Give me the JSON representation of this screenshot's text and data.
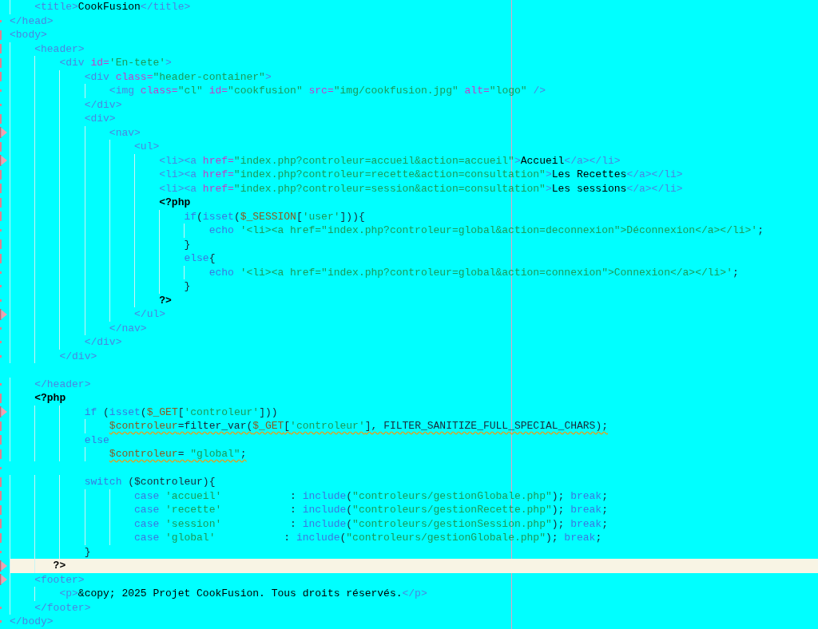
{
  "editor": {
    "lines": [
      {
        "current": false,
        "warning": false,
        "tokens": [
          {
            "kind": "tag",
            "text": "    <title>"
          },
          {
            "kind": "text",
            "text": "CookFusion"
          },
          {
            "kind": "tag",
            "text": "</title>"
          }
        ]
      },
      {
        "marker": {
          "kind": "dot"
        },
        "current": false,
        "warning": false,
        "tokens": [
          {
            "kind": "tag",
            "text": "</head>"
          }
        ]
      },
      {
        "marker": {
          "kind": "bar"
        },
        "current": false,
        "warning": false,
        "tokens": [
          {
            "kind": "tag",
            "text": "<body>"
          }
        ]
      },
      {
        "marker": {
          "kind": "bar"
        },
        "current": false,
        "warning": false,
        "tokens": [
          {
            "kind": "tag",
            "text": "    <header>"
          }
        ]
      },
      {
        "marker": {
          "kind": "bar"
        },
        "current": false,
        "warning": false,
        "tokens": [
          {
            "kind": "tag",
            "text": "        <div "
          },
          {
            "kind": "attr",
            "text": "id="
          },
          {
            "kind": "string",
            "text": "'En-tete'"
          },
          {
            "kind": "tag",
            "text": ">"
          }
        ]
      },
      {
        "marker": {
          "kind": "bar"
        },
        "current": false,
        "warning": false,
        "tokens": [
          {
            "kind": "tag",
            "text": "            <div "
          },
          {
            "kind": "attr",
            "text": "class="
          },
          {
            "kind": "string",
            "text": "\"header-container\""
          },
          {
            "kind": "tag",
            "text": ">"
          }
        ]
      },
      {
        "marker": {
          "kind": "dot"
        },
        "current": false,
        "warning": false,
        "tokens": [
          {
            "kind": "tag",
            "text": "                <img "
          },
          {
            "kind": "attr",
            "text": "class="
          },
          {
            "kind": "string",
            "text": "\"cl\""
          },
          {
            "kind": "attr",
            "text": " id="
          },
          {
            "kind": "string",
            "text": "\"cookfusion\""
          },
          {
            "kind": "attr",
            "text": " src="
          },
          {
            "kind": "string",
            "text": "\"img/cookfusion.jpg\""
          },
          {
            "kind": "attr",
            "text": " alt="
          },
          {
            "kind": "string",
            "text": "\"logo\""
          },
          {
            "kind": "tag",
            "text": " />"
          }
        ]
      },
      {
        "marker": {
          "kind": "dot"
        },
        "current": false,
        "warning": false,
        "tokens": [
          {
            "kind": "tag",
            "text": "            </div>"
          }
        ]
      },
      {
        "marker": {
          "kind": "bar"
        },
        "current": false,
        "warning": false,
        "tokens": [
          {
            "kind": "tag",
            "text": "            <div>"
          }
        ]
      },
      {
        "marker": {
          "kind": "arrow"
        },
        "current": false,
        "warning": false,
        "tokens": [
          {
            "kind": "tag",
            "text": "                <nav>"
          }
        ]
      },
      {
        "marker": {
          "kind": "bar"
        },
        "current": false,
        "warning": false,
        "tokens": [
          {
            "kind": "tag",
            "text": "                    <ul>"
          }
        ]
      },
      {
        "marker": {
          "kind": "arrow"
        },
        "current": false,
        "warning": false,
        "tokens": [
          {
            "kind": "tag",
            "text": "                        <li><a "
          },
          {
            "kind": "attr",
            "text": "href="
          },
          {
            "kind": "string",
            "text": "\"index.php?controleur=accueil&action=accueil\""
          },
          {
            "kind": "tag",
            "text": ">"
          },
          {
            "kind": "text",
            "text": "Accueil"
          },
          {
            "kind": "tag",
            "text": "</a></li>"
          }
        ]
      },
      {
        "marker": {
          "kind": "bar"
        },
        "current": false,
        "warning": false,
        "tokens": [
          {
            "kind": "tag",
            "text": "                        <li><a "
          },
          {
            "kind": "attr",
            "text": "href="
          },
          {
            "kind": "string",
            "text": "\"index.php?controleur=recette&action=consultation\""
          },
          {
            "kind": "tag",
            "text": ">"
          },
          {
            "kind": "text",
            "text": "Les Recettes"
          },
          {
            "kind": "tag",
            "text": "</a></li>"
          }
        ]
      },
      {
        "marker": {
          "kind": "bar"
        },
        "current": false,
        "warning": false,
        "tokens": [
          {
            "kind": "tag",
            "text": "                        <li><a "
          },
          {
            "kind": "attr",
            "text": "href="
          },
          {
            "kind": "string",
            "text": "\"index.php?controleur=session&action=consultation\""
          },
          {
            "kind": "tag",
            "text": ">"
          },
          {
            "kind": "text",
            "text": "Les sessions"
          },
          {
            "kind": "tag",
            "text": "</a></li>"
          }
        ]
      },
      {
        "marker": {
          "kind": "bar"
        },
        "current": false,
        "warning": false,
        "tokens": [
          {
            "kind": "php",
            "text": "                        <?php"
          }
        ]
      },
      {
        "marker": {
          "kind": "bar"
        },
        "current": false,
        "warning": false,
        "tokens": [
          {
            "kind": "keyword",
            "text": "                            if"
          },
          {
            "kind": "plain",
            "text": "("
          },
          {
            "kind": "keyword",
            "text": "isset"
          },
          {
            "kind": "plain",
            "text": "("
          },
          {
            "kind": "var",
            "text": "$_SESSION"
          },
          {
            "kind": "plain",
            "text": "["
          },
          {
            "kind": "string",
            "text": "'user'"
          },
          {
            "kind": "plain",
            "text": "])){"
          }
        ]
      },
      {
        "marker": {
          "kind": "dot"
        },
        "current": false,
        "warning": false,
        "tokens": [
          {
            "kind": "keyword",
            "text": "                                echo"
          },
          {
            "kind": "string",
            "text": " '<li><a href=\"index.php?controleur=global&action=deconnexion\">Déconnexion</a></li>'"
          },
          {
            "kind": "plain",
            "text": ";"
          }
        ]
      },
      {
        "marker": {
          "kind": "bar"
        },
        "current": false,
        "warning": false,
        "tokens": [
          {
            "kind": "plain",
            "text": "                            }"
          }
        ]
      },
      {
        "marker": {
          "kind": "bar"
        },
        "current": false,
        "warning": false,
        "tokens": [
          {
            "kind": "keyword",
            "text": "                            else"
          },
          {
            "kind": "plain",
            "text": "{"
          }
        ]
      },
      {
        "marker": {
          "kind": "dot"
        },
        "current": false,
        "warning": false,
        "tokens": [
          {
            "kind": "keyword",
            "text": "                                echo"
          },
          {
            "kind": "string",
            "text": " '<li><a href=\"index.php?controleur=global&action=connexion\">Connexion</a></li>'"
          },
          {
            "kind": "plain",
            "text": ";"
          }
        ]
      },
      {
        "marker": {
          "kind": "dot"
        },
        "current": false,
        "warning": false,
        "tokens": [
          {
            "kind": "plain",
            "text": "                            }"
          }
        ]
      },
      {
        "marker": {
          "kind": "dot"
        },
        "current": false,
        "warning": false,
        "tokens": [
          {
            "kind": "php",
            "text": "                        ?>"
          }
        ]
      },
      {
        "marker": {
          "kind": "arrow"
        },
        "current": false,
        "warning": false,
        "tokens": [
          {
            "kind": "tag",
            "text": "                    </ul>"
          }
        ]
      },
      {
        "marker": {
          "kind": "dot"
        },
        "current": false,
        "warning": false,
        "tokens": [
          {
            "kind": "tag",
            "text": "                </nav>"
          }
        ]
      },
      {
        "marker": {
          "kind": "dot"
        },
        "current": false,
        "warning": false,
        "tokens": [
          {
            "kind": "tag",
            "text": "            </div>"
          }
        ]
      },
      {
        "marker": {
          "kind": "dot"
        },
        "current": false,
        "warning": false,
        "tokens": [
          {
            "kind": "tag",
            "text": "        </div>"
          }
        ]
      },
      {
        "current": false
      },
      {
        "marker": {
          "kind": "dot"
        },
        "current": false,
        "warning": false,
        "tokens": [
          {
            "kind": "tag",
            "text": "    </header>"
          }
        ]
      },
      {
        "marker": {
          "kind": "bar"
        },
        "current": false,
        "warning": false,
        "tokens": [
          {
            "kind": "php",
            "text": "    <?php"
          }
        ]
      },
      {
        "marker": {
          "kind": "arrow"
        },
        "current": false,
        "warning": false,
        "tokens": [
          {
            "kind": "keyword",
            "text": "            if"
          },
          {
            "kind": "plain",
            "text": " ("
          },
          {
            "kind": "keyword",
            "text": "isset"
          },
          {
            "kind": "plain",
            "text": "("
          },
          {
            "kind": "var",
            "text": "$_GET"
          },
          {
            "kind": "plain",
            "text": "["
          },
          {
            "kind": "string",
            "text": "'controleur'"
          },
          {
            "kind": "plain",
            "text": "]))"
          }
        ]
      },
      {
        "marker": {
          "kind": "bar"
        },
        "current": false,
        "warning": true,
        "tokens": [
          {
            "kind": "var",
            "text": "                $controleur"
          },
          {
            "kind": "plain",
            "text": "=filter_var("
          },
          {
            "kind": "var",
            "text": "$_GET"
          },
          {
            "kind": "plain",
            "text": "["
          },
          {
            "kind": "string",
            "text": "'controleur'"
          },
          {
            "kind": "plain",
            "text": "], FILTER_SANITIZE_FULL_SPECIAL_CHARS);"
          }
        ]
      },
      {
        "marker": {
          "kind": "bar"
        },
        "current": false,
        "warning": false,
        "tokens": [
          {
            "kind": "keyword",
            "text": "            else"
          }
        ]
      },
      {
        "marker": {
          "kind": "bar"
        },
        "current": false,
        "warning": true,
        "tokens": [
          {
            "kind": "var",
            "text": "                $controleur"
          },
          {
            "kind": "plain",
            "text": "= "
          },
          {
            "kind": "string",
            "text": "\"global\""
          },
          {
            "kind": "plain",
            "text": ";"
          }
        ]
      },
      {
        "marker": {
          "kind": "dot"
        },
        "current": false
      },
      {
        "marker": {
          "kind": "bar"
        },
        "current": false,
        "warning": false,
        "tokens": [
          {
            "kind": "keyword",
            "text": "            switch"
          },
          {
            "kind": "plain",
            "text": " ($controleur){"
          }
        ]
      },
      {
        "marker": {
          "kind": "bar"
        },
        "current": false,
        "warning": false,
        "tokens": [
          {
            "kind": "keyword",
            "text": "                    case"
          },
          {
            "kind": "string",
            "text": " 'accueil'"
          },
          {
            "kind": "plain",
            "text": "           : "
          },
          {
            "kind": "keyword",
            "text": "include"
          },
          {
            "kind": "plain",
            "text": "("
          },
          {
            "kind": "string",
            "text": "\"controleurs/gestionGlobale.php\""
          },
          {
            "kind": "plain",
            "text": "); "
          },
          {
            "kind": "keyword",
            "text": "break"
          },
          {
            "kind": "plain",
            "text": ";"
          }
        ]
      },
      {
        "marker": {
          "kind": "bar"
        },
        "current": false,
        "warning": false,
        "tokens": [
          {
            "kind": "keyword",
            "text": "                    case"
          },
          {
            "kind": "string",
            "text": " 'recette'"
          },
          {
            "kind": "plain",
            "text": "           : "
          },
          {
            "kind": "keyword",
            "text": "include"
          },
          {
            "kind": "plain",
            "text": "("
          },
          {
            "kind": "string",
            "text": "\"controleurs/gestionRecette.php\""
          },
          {
            "kind": "plain",
            "text": "); "
          },
          {
            "kind": "keyword",
            "text": "break"
          },
          {
            "kind": "plain",
            "text": ";"
          }
        ]
      },
      {
        "marker": {
          "kind": "bar"
        },
        "current": false,
        "warning": false,
        "tokens": [
          {
            "kind": "keyword",
            "text": "                    case"
          },
          {
            "kind": "string",
            "text": " 'session'"
          },
          {
            "kind": "plain",
            "text": "           : "
          },
          {
            "kind": "keyword",
            "text": "include"
          },
          {
            "kind": "plain",
            "text": "("
          },
          {
            "kind": "string",
            "text": "\"controleurs/gestionSession.php\""
          },
          {
            "kind": "plain",
            "text": "); "
          },
          {
            "kind": "keyword",
            "text": "break"
          },
          {
            "kind": "plain",
            "text": ";"
          }
        ]
      },
      {
        "marker": {
          "kind": "bar"
        },
        "current": false,
        "warning": false,
        "tokens": [
          {
            "kind": "keyword",
            "text": "                    case"
          },
          {
            "kind": "string",
            "text": " 'global'"
          },
          {
            "kind": "plain",
            "text": "           : "
          },
          {
            "kind": "keyword",
            "text": "include"
          },
          {
            "kind": "plain",
            "text": "("
          },
          {
            "kind": "string",
            "text": "\"controleurs/gestionGlobale.php\""
          },
          {
            "kind": "plain",
            "text": "); "
          },
          {
            "kind": "keyword",
            "text": "break"
          },
          {
            "kind": "plain",
            "text": ";"
          }
        ]
      },
      {
        "marker": {
          "kind": "dot"
        },
        "current": false,
        "warning": false,
        "tokens": [
          {
            "kind": "plain",
            "text": "            }"
          }
        ]
      },
      {
        "marker": {
          "kind": "arrow"
        },
        "current": true,
        "warning": false,
        "tokens": [
          {
            "kind": "php",
            "text": "       ?>"
          }
        ]
      },
      {
        "marker": {
          "kind": "arrow"
        },
        "current": false,
        "warning": false,
        "tokens": [
          {
            "kind": "tag",
            "text": "    <footer>"
          }
        ]
      },
      {
        "current": false,
        "warning": false,
        "tokens": [
          {
            "kind": "tag",
            "text": "        <p>"
          },
          {
            "kind": "text",
            "text": "&copy; 2025 Projet CookFusion. Tous droits réservés."
          },
          {
            "kind": "tag",
            "text": "</p>"
          }
        ]
      },
      {
        "marker": {
          "kind": "dot"
        },
        "current": false,
        "warning": false,
        "tokens": [
          {
            "kind": "tag",
            "text": "    </footer>"
          }
        ]
      },
      {
        "marker": {
          "kind": "dot"
        },
        "current": false,
        "warning": false,
        "tokens": [
          {
            "kind": "tag",
            "text": "</body>"
          }
        ]
      }
    ]
  }
}
